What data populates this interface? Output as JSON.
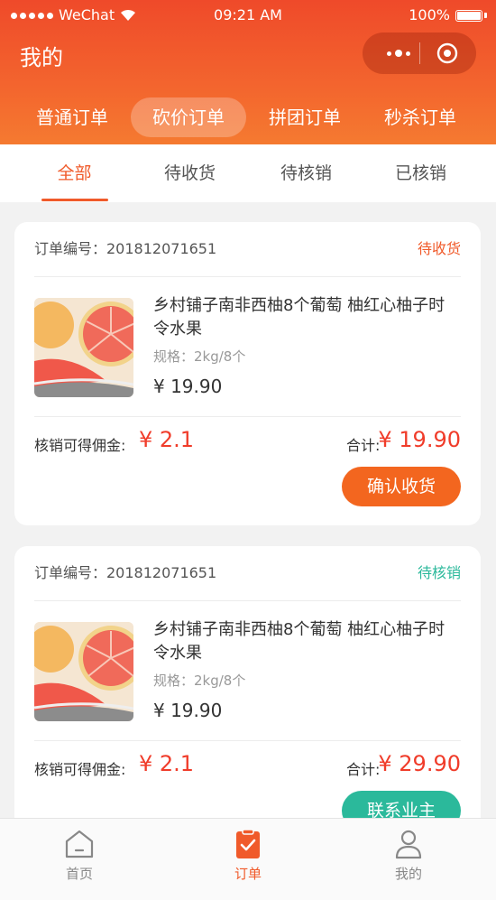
{
  "status_bar": {
    "carrier": "WeChat",
    "time": "09:21 AM",
    "battery": "100%"
  },
  "header": {
    "title": "我的"
  },
  "order_types": [
    {
      "label": "普通订单",
      "active": false
    },
    {
      "label": "砍价订单",
      "active": true
    },
    {
      "label": "拼团订单",
      "active": false
    },
    {
      "label": "秒杀订单",
      "active": false
    }
  ],
  "sub_tabs": [
    {
      "label": "全部",
      "active": true
    },
    {
      "label": "待收货",
      "active": false
    },
    {
      "label": "待核销",
      "active": false
    },
    {
      "label": "已核销",
      "active": false
    }
  ],
  "orders": [
    {
      "order_no_label": "订单编号：201812071651",
      "status": "待收货",
      "status_color": "#f05a2a",
      "product_name": "乡村铺子南非西柚8个葡萄 柚红心柚子时令水果",
      "spec": "规格：2kg/8个",
      "price": "¥ 19.90",
      "commission_label": "核销可得佣金:",
      "commission_value": "¥ 2.1",
      "total_label": "合计:",
      "total_value": "¥ 19.90",
      "button_label": "确认收货"
    },
    {
      "order_no_label": "订单编号：201812071651",
      "status": "待核销",
      "status_color": "#2bb99b",
      "product_name": "乡村铺子南非西柚8个葡萄 柚红心柚子时令水果",
      "spec": "规格：2kg/8个",
      "price": "¥ 19.90",
      "commission_label": "核销可得佣金:",
      "commission_value": "¥ 2.1",
      "total_label": "合计:",
      "total_value": "¥ 29.90",
      "button_label": "联系业主"
    }
  ],
  "tabbar": [
    {
      "label": "首页",
      "icon": "home-icon",
      "active": false
    },
    {
      "label": "订单",
      "icon": "order-icon",
      "active": true
    },
    {
      "label": "我的",
      "icon": "profile-icon",
      "active": false
    }
  ],
  "colors": {
    "brand": "#ef4a2a",
    "accent": "#f05a2a",
    "price": "#f03c2a",
    "teal": "#2bb99b"
  }
}
